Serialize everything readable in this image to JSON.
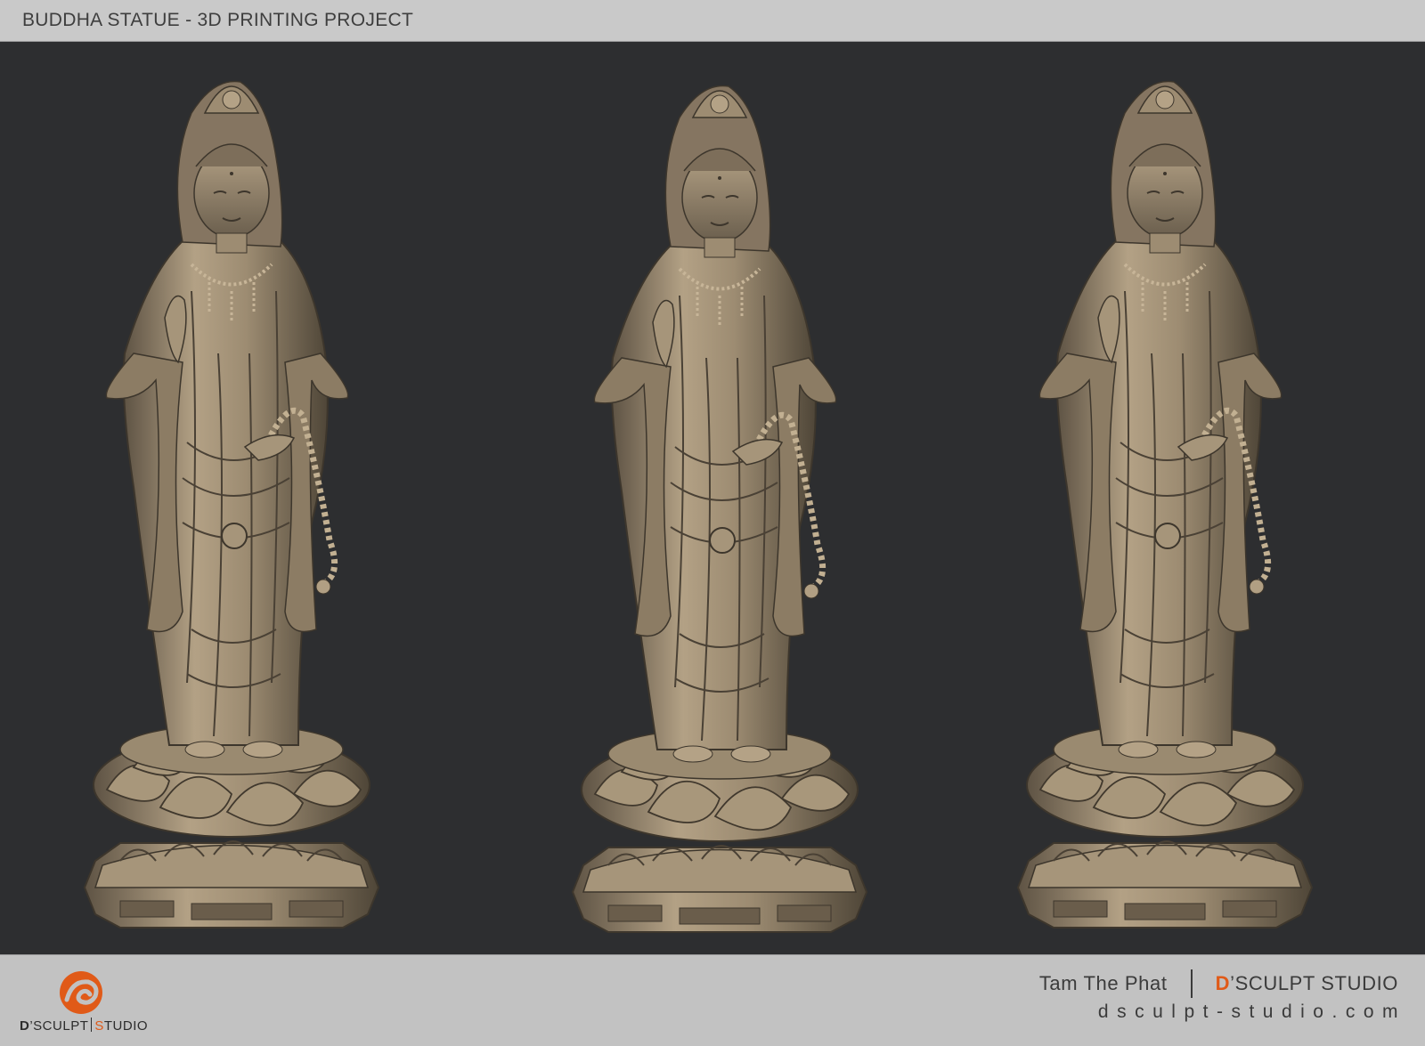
{
  "header": {
    "title": "BUDDHA STATUE - 3D PRINTING PROJECT"
  },
  "viewport": {
    "statues": [
      {
        "view": "front-left"
      },
      {
        "view": "front"
      },
      {
        "view": "side"
      }
    ]
  },
  "footer": {
    "logo_d": "D",
    "logo_sculpt": "’SCULPT",
    "logo_s": "S",
    "logo_tudio": "TUDIO",
    "artist": "Tam The Phat",
    "studio_first": "D",
    "studio_rest": "’SCULPT STUDIO",
    "website": "dsculpt-studio.com"
  },
  "colors": {
    "accent": "#e05a18",
    "bronze": "#a08e74",
    "background": "#2d2e30"
  }
}
